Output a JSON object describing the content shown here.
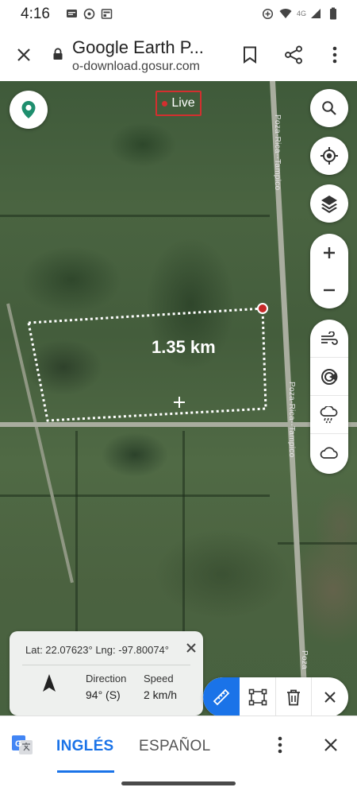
{
  "status_bar": {
    "time": "4:16",
    "network": "4G",
    "left_icons": [
      "message-icon",
      "whatsapp-icon",
      "news-icon"
    ],
    "right_icons": [
      "data-saver-icon",
      "wifi-icon",
      "signal-icon",
      "battery-icon"
    ]
  },
  "browser": {
    "title": "Google Earth P...",
    "url": "o-download.gosur.com"
  },
  "map": {
    "live_label": "Live",
    "distance_label": "1.35 km",
    "road_labels": [
      "Poza-Rica--Tampico",
      "Poza-Rica--Tampico",
      "Poza"
    ],
    "right_controls": [
      "search-icon",
      "my-location-icon",
      "layers-icon",
      "zoom-in-icon",
      "zoom-out-icon",
      "wind-icon",
      "radar-icon",
      "rain-icon",
      "cloud-icon"
    ]
  },
  "info_panel": {
    "coords": "Lat: 22.07623°  Lng: -97.80074°",
    "direction_label": "Direction",
    "direction_value": "94° (S)",
    "speed_label": "Speed",
    "speed_value": "2 km/h"
  },
  "tools": [
    "ruler-icon",
    "polygon-icon",
    "trash-icon",
    "close-icon"
  ],
  "translate": {
    "tab_source": "INGLÉS",
    "tab_target": "ESPAÑOL"
  },
  "colors": {
    "accent": "#1a73e8",
    "live_red": "#d32f2f",
    "brand_teal": "#1e8e6e"
  }
}
